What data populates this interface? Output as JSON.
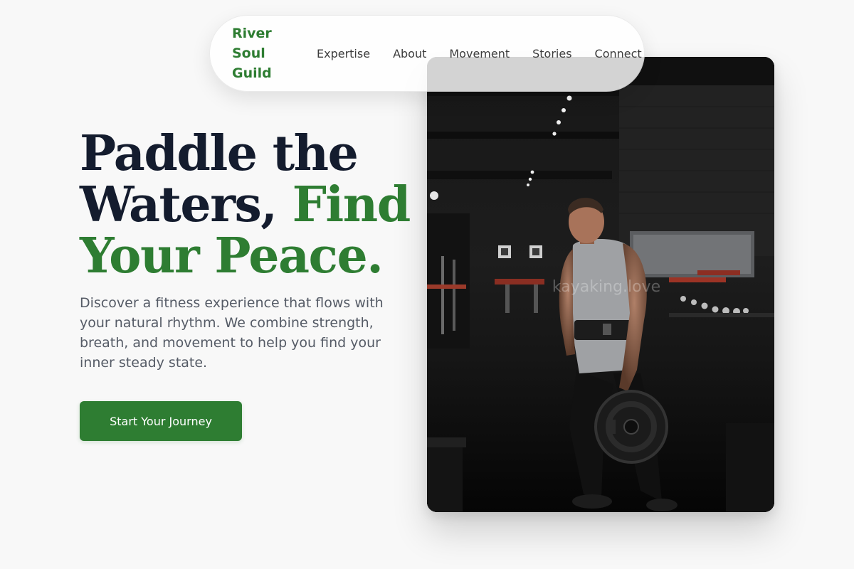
{
  "nav": {
    "brand_lines": [
      "River",
      "Soul",
      "Guild"
    ],
    "links": [
      {
        "label": "Expertise"
      },
      {
        "label": "About"
      },
      {
        "label": "Movement"
      },
      {
        "label": "Stories"
      },
      {
        "label": "Connect"
      }
    ]
  },
  "hero": {
    "title_line1": "Paddle the",
    "title_line2_dark": "Waters, ",
    "title_line2_accent": "Find",
    "title_line3_accent": "Your Peace.",
    "subtitle": "Discover a fitness experience that flows with your natural rhythm. We combine strength, breath, and movement to help you find your inner steady state.",
    "cta_label": "Start Your Journey",
    "image_watermark": "kayaking.love"
  },
  "colors": {
    "accent": "#2e7d32",
    "heading_dark": "#141c2e",
    "body_text": "#555b66",
    "page_bg": "#f8f8f8"
  },
  "icons": {
    "image_subject": "man-with-weight-plate-in-gym"
  }
}
